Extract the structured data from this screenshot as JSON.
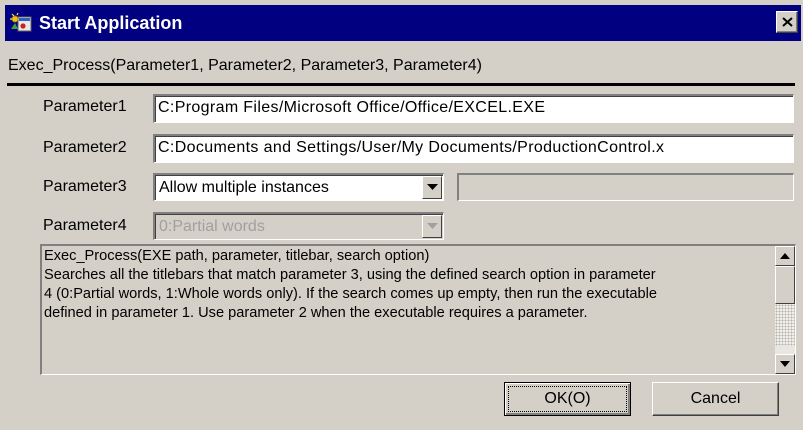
{
  "window": {
    "title": "Start Application",
    "icon": "application-icon",
    "close_icon": "close-icon"
  },
  "function_signature": "Exec_Process(Parameter1, Parameter2, Parameter3, Parameter4)",
  "parameters": {
    "p1": {
      "label": "Parameter1",
      "value": "C:Program Files/Microsoft Office/Office/EXCEL.EXE"
    },
    "p2": {
      "label": "Parameter2",
      "value": "C:Documents and Settings/User/My Documents/ProductionControl.x"
    },
    "p3": {
      "label": "Parameter3",
      "selected": "Allow multiple instances",
      "extra_value": ""
    },
    "p4": {
      "label": "Parameter4",
      "selected": "0:Partial words",
      "disabled": true
    }
  },
  "description": {
    "lines": [
      "Exec_Process(EXE path, parameter, titlebar, search option)",
      "Searches all the titlebars that match parameter 3, using the defined search option in parameter",
      "4 (0:Partial words, 1:Whole words only). If the search comes up empty, then run the executable",
      "defined in parameter 1. Use parameter 2 when the executable requires a parameter."
    ]
  },
  "buttons": {
    "ok": "OK(O)",
    "cancel": "Cancel"
  },
  "colors": {
    "titlebar": "#000080",
    "face": "#d4d0c8"
  }
}
